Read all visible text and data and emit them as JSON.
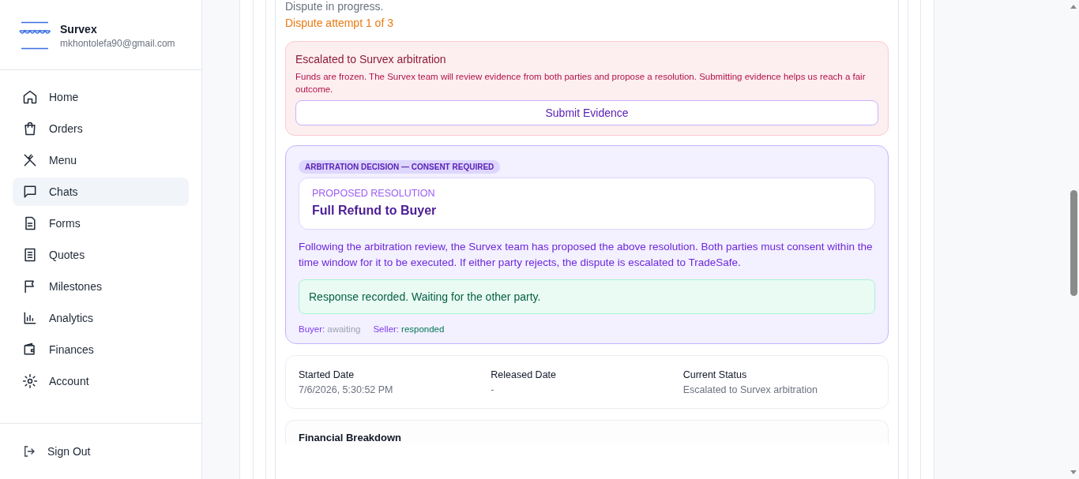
{
  "sidebar": {
    "brand": "Survex",
    "email": "mkhontolefa90@gmail.com",
    "items": [
      {
        "label": "Home",
        "selected": false
      },
      {
        "label": "Orders",
        "selected": false
      },
      {
        "label": "Menu",
        "selected": false
      },
      {
        "label": "Chats",
        "selected": true
      },
      {
        "label": "Forms",
        "selected": false
      },
      {
        "label": "Quotes",
        "selected": false
      },
      {
        "label": "Milestones",
        "selected": false
      },
      {
        "label": "Analytics",
        "selected": false
      },
      {
        "label": "Finances",
        "selected": false
      },
      {
        "label": "Account",
        "selected": false
      }
    ],
    "sign_out": "Sign Out"
  },
  "dispute": {
    "status_text": "Dispute in progress.",
    "attempt": "Dispute attempt 1 of 3",
    "escalation": {
      "title": "Escalated to Survex arbitration",
      "text": "Funds are frozen. The Survex team will review evidence from both parties and propose a resolution. Submitting evidence helps us reach a fair outcome.",
      "button": "Submit Evidence"
    },
    "decision": {
      "badge": "ARBITRATION DECISION — CONSENT REQUIRED",
      "resolution_label": "PROPOSED RESOLUTION",
      "resolution": "Full Refund to Buyer",
      "text": "Following the arbitration review, the Survex team has proposed the above resolution. Both parties must consent within the time window for it to be executed. If either party rejects, the dispute is escalated to TradeSafe.",
      "notice": "Response recorded. Waiting for the other party.",
      "parties": [
        {
          "label": "Buyer:",
          "status": "awaiting",
          "responded": false
        },
        {
          "label": "Seller:",
          "status": "responded",
          "responded": true
        }
      ]
    },
    "dates": [
      {
        "label": "Started Date",
        "value": "7/6/2026, 5:30:52 PM"
      },
      {
        "label": "Released Date",
        "value": "-"
      },
      {
        "label": "Current Status",
        "value": "Escalated to Survex arbitration"
      }
    ],
    "financial_title": "Financial Breakdown"
  }
}
